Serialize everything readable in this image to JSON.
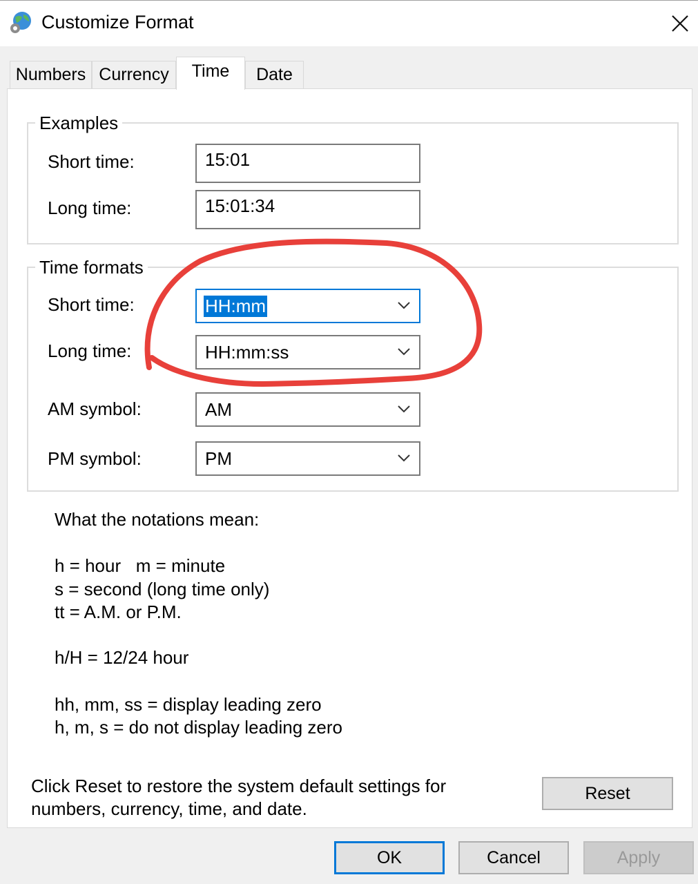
{
  "window": {
    "title": "Customize Format",
    "icon": "globe-settings-icon",
    "close_icon": "close-icon"
  },
  "tabs": [
    {
      "label": "Numbers",
      "active": false
    },
    {
      "label": "Currency",
      "active": false
    },
    {
      "label": "Time",
      "active": true
    },
    {
      "label": "Date",
      "active": false
    }
  ],
  "examples": {
    "title": "Examples",
    "short_time_label": "Short time:",
    "short_time_value": "15:01",
    "long_time_label": "Long time:",
    "long_time_value": "15:01:34"
  },
  "time_formats": {
    "title": "Time formats",
    "short_time_label": "Short time:",
    "short_time_value": "HH:mm",
    "long_time_label": "Long time:",
    "long_time_value": "HH:mm:ss",
    "am_label": "AM symbol:",
    "am_value": "AM",
    "pm_label": "PM symbol:",
    "pm_value": "PM"
  },
  "notations": {
    "heading": "What the notations mean:",
    "line1": "h = hour   m = minute",
    "line2": "s = second (long time only)",
    "line3": "tt = A.M. or P.M.",
    "line4": "h/H = 12/24 hour",
    "line5": "hh, mm, ss = display leading zero",
    "line6": "h, m, s = do not display leading zero"
  },
  "reset": {
    "text_line1": "Click Reset to restore the system default settings for",
    "text_line2": "numbers, currency, time, and date.",
    "button_label": "Reset"
  },
  "footer": {
    "ok_label": "OK",
    "cancel_label": "Cancel",
    "apply_label": "Apply"
  },
  "colors": {
    "accent": "#0078d7",
    "annotation": "#e8403a"
  }
}
